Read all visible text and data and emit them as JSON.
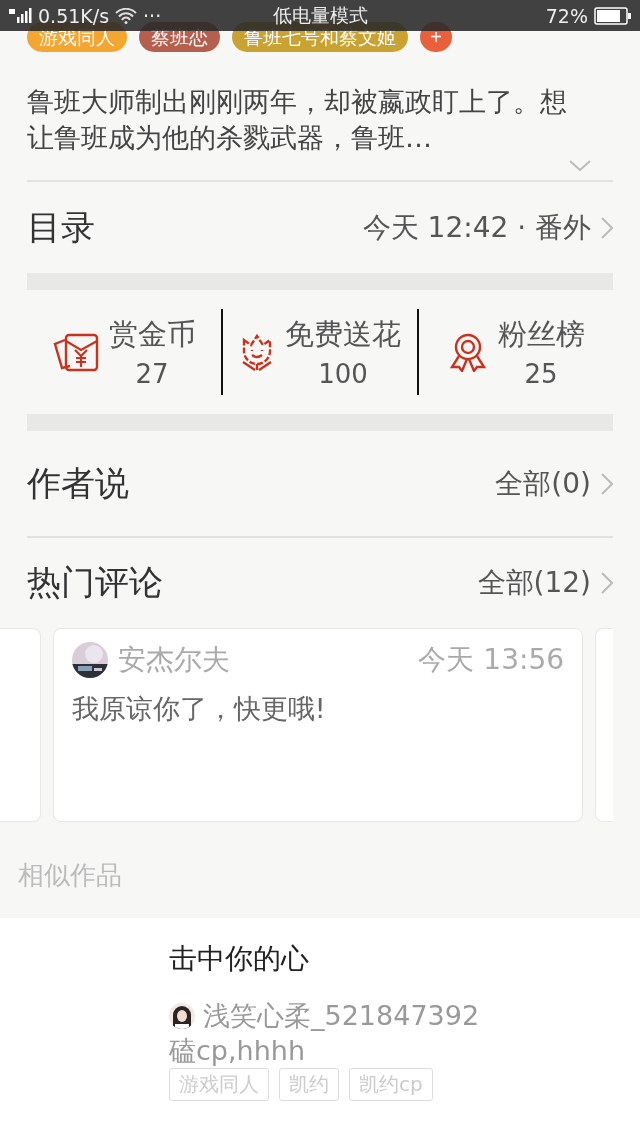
{
  "status_bar": {
    "speed": "0.51K/s",
    "dots": "···",
    "mode": "低电量模式",
    "battery": "72%"
  },
  "tags": [
    {
      "label": "游戏同人",
      "color": "#f5a630"
    },
    {
      "label": "蔡班恋",
      "color": "#b5604f"
    },
    {
      "label": "鲁班七号和蔡文姬",
      "color": "#c9a232"
    }
  ],
  "add_tag": "+",
  "description": "鲁班大师制出刚刚两年，却被嬴政盯上了。想让鲁班成为他的杀戮武器，鲁班…",
  "catalog": {
    "title": "目录",
    "latest": "今天 12:42 · 番外"
  },
  "rewards": [
    {
      "kind": "envelope",
      "label": "赏金币",
      "count": "27"
    },
    {
      "kind": "flower",
      "label": "免费送花",
      "count": "100"
    },
    {
      "kind": "medal",
      "label": "粉丝榜",
      "count": "25"
    }
  ],
  "author_says": {
    "title": "作者说",
    "all": "全部(0)"
  },
  "hot_comments": {
    "title": "热门评论",
    "all": "全部(12)",
    "comments": [
      {
        "user": "安杰尔夫",
        "time": "今天 13:56",
        "text": "我原谅你了，快更哦!"
      }
    ]
  },
  "similar": {
    "title": "相似作品",
    "items": [
      {
        "title": "击中你的心",
        "author": "浅笑心柔_521847392",
        "summary": "磕cp,hhhh",
        "tags": [
          "游戏同人",
          "凯约",
          "凯约cp"
        ]
      }
    ]
  }
}
